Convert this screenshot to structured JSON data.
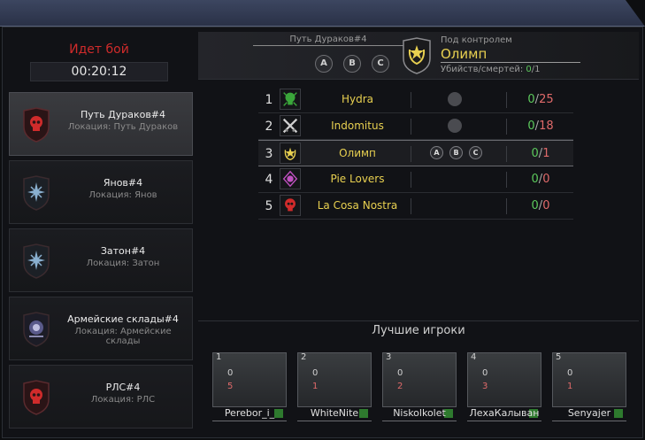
{
  "battle": {
    "status": "Идет бой",
    "timer": "00:20:12"
  },
  "locations": [
    {
      "name": "Путь Дураков#4",
      "sub": "Локация: Путь Дураков",
      "icon": "red-skull-icon",
      "active": true
    },
    {
      "name": "Янов#4",
      "sub": "Локация: Янов",
      "icon": "blue-star-icon",
      "active": false
    },
    {
      "name": "Затон#4",
      "sub": "Локация: Затон",
      "icon": "blue-star-icon",
      "active": false
    },
    {
      "name": "Армейские склады#4",
      "sub": "Локация: Армейские склады",
      "icon": "purple-emblem-icon",
      "active": false
    },
    {
      "name": "РЛС#4",
      "sub": "Локация: РЛС",
      "icon": "red-skull-icon",
      "active": false
    }
  ],
  "header": {
    "route": "Путь Дураков#4",
    "points": [
      "A",
      "B",
      "C"
    ],
    "control_label": "Под контролем",
    "control_name": "Олимп",
    "kd_label": "Убийств/смертей:",
    "kills": "0",
    "deaths": "1"
  },
  "clans": [
    {
      "rank": "1",
      "name": "Hydra",
      "icon": "green-skull-icon",
      "flag": true,
      "points": [],
      "kills": "0",
      "deaths": "25"
    },
    {
      "rank": "2",
      "name": "Indomitus",
      "icon": "crossed-swords-icon",
      "flag": true,
      "points": [],
      "kills": "0",
      "deaths": "18"
    },
    {
      "rank": "3",
      "name": "Олимп",
      "icon": "gold-emblem-icon",
      "flag": false,
      "points": [
        "A",
        "B",
        "C"
      ],
      "kills": "0",
      "deaths": "1"
    },
    {
      "rank": "4",
      "name": "Pie Lovers",
      "icon": "purple-emblem-icon",
      "flag": false,
      "points": [],
      "kills": "0",
      "deaths": "0"
    },
    {
      "rank": "5",
      "name": "La Cosa Nostra",
      "icon": "red-skull-icon",
      "flag": false,
      "points": [],
      "kills": "0",
      "deaths": "0"
    }
  ],
  "best": {
    "title": "Лучшие игроки",
    "players": [
      {
        "num": "1",
        "kills": "0",
        "deaths": "5",
        "name": "Perebor_i_"
      },
      {
        "num": "2",
        "kills": "0",
        "deaths": "1",
        "name": "WhiteNite"
      },
      {
        "num": "3",
        "kills": "0",
        "deaths": "2",
        "name": "Niskolkolet"
      },
      {
        "num": "4",
        "kills": "0",
        "deaths": "3",
        "name": "ЛехаКалыван"
      },
      {
        "num": "5",
        "kills": "0",
        "deaths": "1",
        "name": "Senyajer"
      }
    ]
  },
  "colors": {
    "accent_red": "#d02b2b",
    "clan_gold": "#e8d050",
    "kill_green": "#5cc95c",
    "death_red": "#e06a6a"
  }
}
